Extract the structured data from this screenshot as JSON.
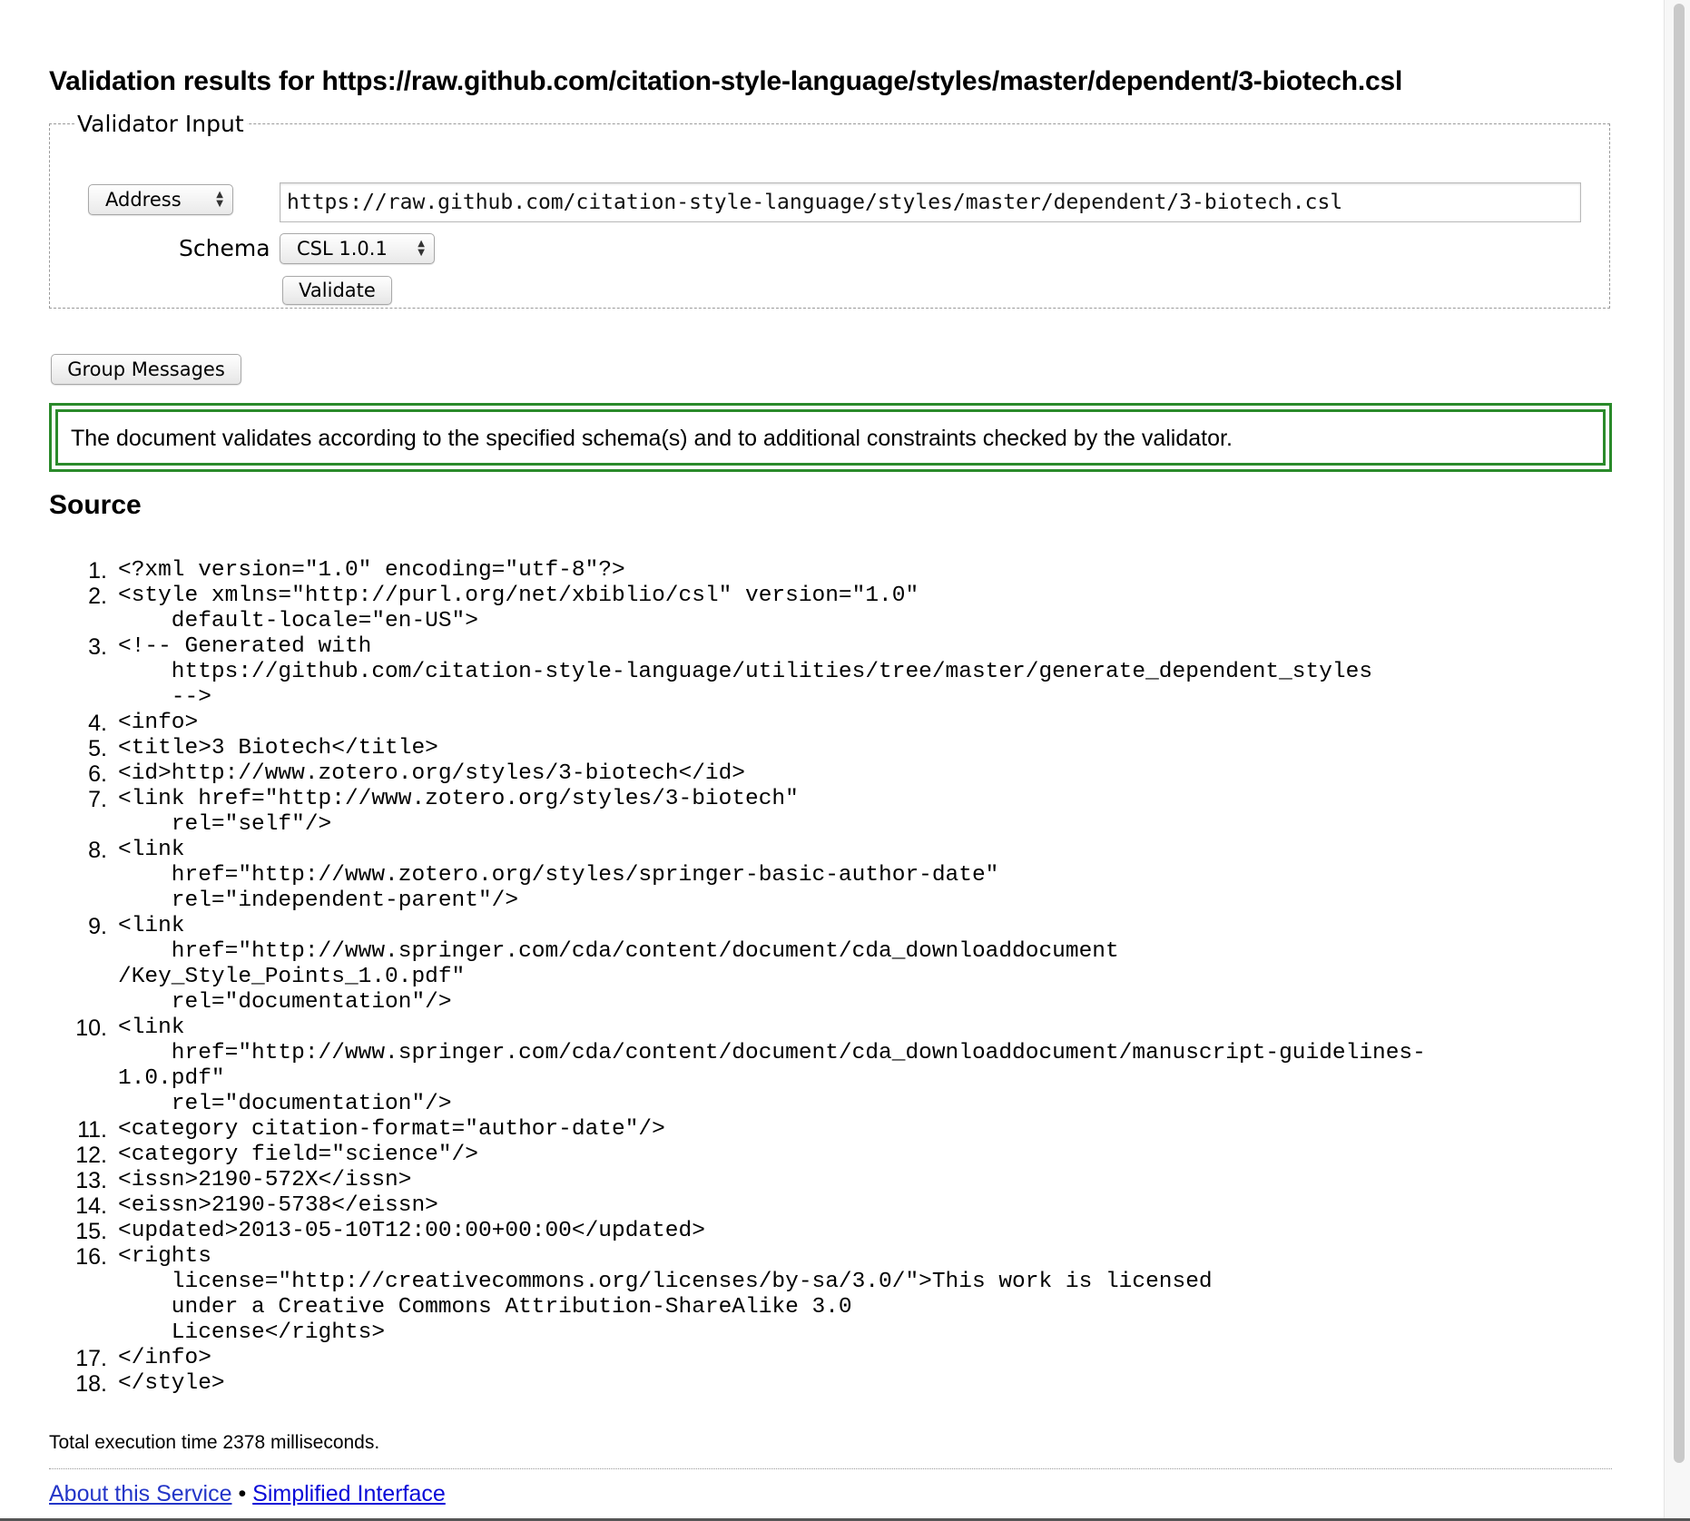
{
  "title": "Validation results for https://raw.github.com/citation-style-language/styles/master/dependent/3-biotech.csl",
  "validator_input": {
    "legend": "Validator Input",
    "input_type_select": "Address",
    "url_value": "https://raw.github.com/citation-style-language/styles/master/dependent/3-biotech.csl",
    "schema_label": "Schema",
    "schema_select": "CSL 1.0.1",
    "validate_button": "Validate"
  },
  "group_messages_button": "Group Messages",
  "success_message": "The document validates according to the specified schema(s) and to additional constraints checked by the validator.",
  "source_heading": "Source",
  "source_lines": [
    "<?xml version=\"1.0\" encoding=\"utf-8\"?>",
    "<style xmlns=\"http://purl.org/net/xbiblio/csl\" version=\"1.0\"\n    default-locale=\"en-US\">",
    "<!-- Generated with\n    https://github.com/citation-style-language/utilities/tree/master/generate_dependent_styles\n    -->",
    "<info>",
    "<title>3 Biotech</title>",
    "<id>http://www.zotero.org/styles/3-biotech</id>",
    "<link href=\"http://www.zotero.org/styles/3-biotech\"\n    rel=\"self\"/>",
    "<link\n    href=\"http://www.zotero.org/styles/springer-basic-author-date\"\n    rel=\"independent-parent\"/>",
    "<link\n    href=\"http://www.springer.com/cda/content/document/cda_downloaddocument\n/Key_Style_Points_1.0.pdf\"\n    rel=\"documentation\"/>",
    "<link\n    href=\"http://www.springer.com/cda/content/document/cda_downloaddocument/manuscript-guidelines-\n1.0.pdf\"\n    rel=\"documentation\"/>",
    "<category citation-format=\"author-date\"/>",
    "<category field=\"science\"/>",
    "<issn>2190-572X</issn>",
    "<eissn>2190-5738</eissn>",
    "<updated>2013-05-10T12:00:00+00:00</updated>",
    "<rights\n    license=\"http://creativecommons.org/licenses/by-sa/3.0/\">This work is licensed\n    under a Creative Commons Attribution-ShareAlike 3.0\n    License</rights>",
    "</info>",
    "</style>"
  ],
  "execution_time": "Total execution time 2378 milliseconds.",
  "footer": {
    "about_link": "About this Service",
    "separator": "•",
    "simplified_link": "Simplified Interface"
  }
}
